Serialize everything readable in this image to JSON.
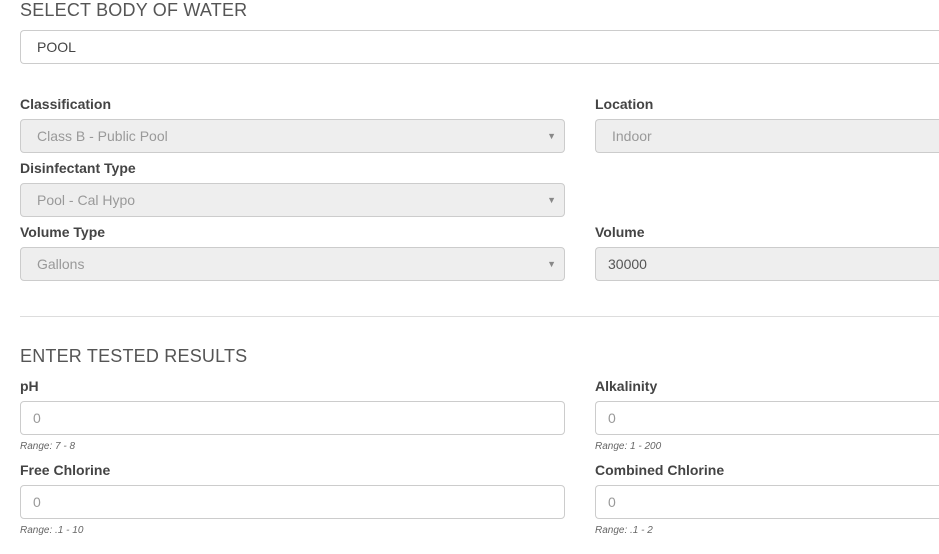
{
  "body_of_water": {
    "title": "SELECT BODY OF WATER",
    "selected_value": "POOL"
  },
  "classification": {
    "label": "Classification",
    "value": "Class B - Public Pool"
  },
  "location": {
    "label": "Location",
    "value": "Indoor"
  },
  "disinfectant_type": {
    "label": "Disinfectant Type",
    "value": "Pool - Cal Hypo"
  },
  "volume_type": {
    "label": "Volume Type",
    "value": "Gallons"
  },
  "volume": {
    "label": "Volume",
    "value": "30000"
  },
  "tested_results": {
    "title": "ENTER TESTED RESULTS",
    "ph": {
      "label": "pH",
      "value": "0",
      "range": "Range: 7 - 8"
    },
    "alkalinity": {
      "label": "Alkalinity",
      "value": "0",
      "range": "Range: 1 - 200"
    },
    "free_chlorine": {
      "label": "Free Chlorine",
      "value": "0",
      "range": "Range: .1 - 10"
    },
    "combined_chlorine": {
      "label": "Combined Chlorine",
      "value": "0",
      "range": "Range: .1 - 2"
    }
  },
  "icons": {
    "select_caret": "caret-down-icon"
  },
  "colors": {
    "disabled_bg": "#eeeeee",
    "border": "#cccccc",
    "label_text": "#444444",
    "muted_text": "#999999"
  }
}
